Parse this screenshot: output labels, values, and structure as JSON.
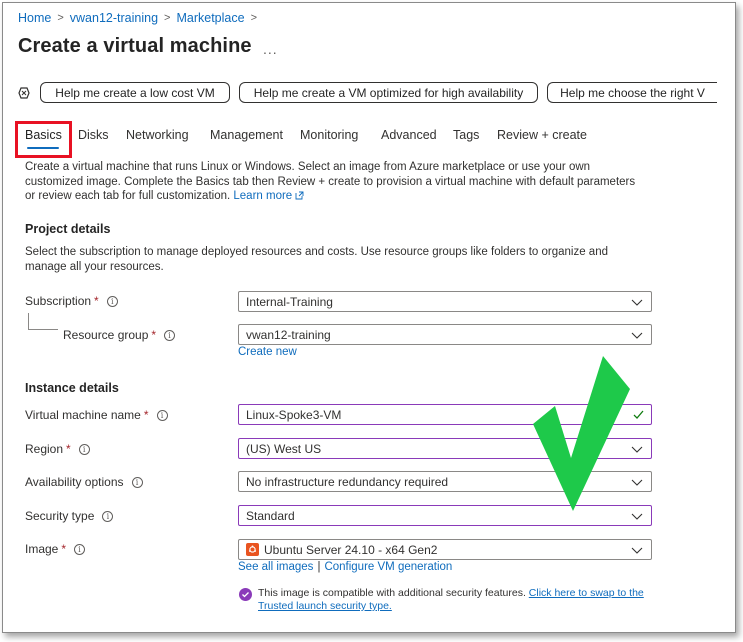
{
  "breadcrumb": {
    "items": [
      "Home",
      "vwan12-training",
      "Marketplace"
    ],
    "separator": ">"
  },
  "page": {
    "title": "Create a virtual machine",
    "more": "..."
  },
  "help_buttons": [
    "Help me create a low cost VM",
    "Help me create a VM optimized for high availability",
    "Help me choose the right V"
  ],
  "tabs": [
    "Basics",
    "Disks",
    "Networking",
    "Management",
    "Monitoring",
    "Advanced",
    "Tags",
    "Review + create"
  ],
  "active_tab": "Basics",
  "intro": {
    "text": "Create a virtual machine that runs Linux or Windows. Select an image from Azure marketplace or use your own customized image. Complete the Basics tab then Review + create to provision a virtual machine with default parameters or review each tab for full customization.",
    "link": "Learn more"
  },
  "project": {
    "heading": "Project details",
    "description": "Select the subscription to manage deployed resources and costs. Use resource groups like folders to organize and manage all your resources.",
    "subscription_label": "Subscription",
    "subscription_value": "Internal-Training",
    "resource_group_label": "Resource group",
    "resource_group_value": "vwan12-training",
    "create_new": "Create new"
  },
  "instance": {
    "heading": "Instance details",
    "vm_name_label": "Virtual machine name",
    "vm_name_value": "Linux-Spoke3-VM",
    "region_label": "Region",
    "region_value": "(US) West US",
    "availability_label": "Availability options",
    "availability_value": "No infrastructure redundancy required",
    "security_label": "Security type",
    "security_value": "Standard",
    "image_label": "Image",
    "image_value": "Ubuntu Server 24.10 - x64 Gen2",
    "see_all_images": "See all images",
    "divider": "|",
    "configure_vm": "Configure VM generation"
  },
  "notice": {
    "text": "This image is compatible with additional security features.",
    "link": "Click here to swap to the Trusted launch security type."
  },
  "colors": {
    "link": "#0f6cbd",
    "highlight_box": "#e81123",
    "checkmark": "#1ec94a",
    "field_focus": "#8a3ab9",
    "valid_check": "#107c10",
    "required": "#a4262c"
  }
}
